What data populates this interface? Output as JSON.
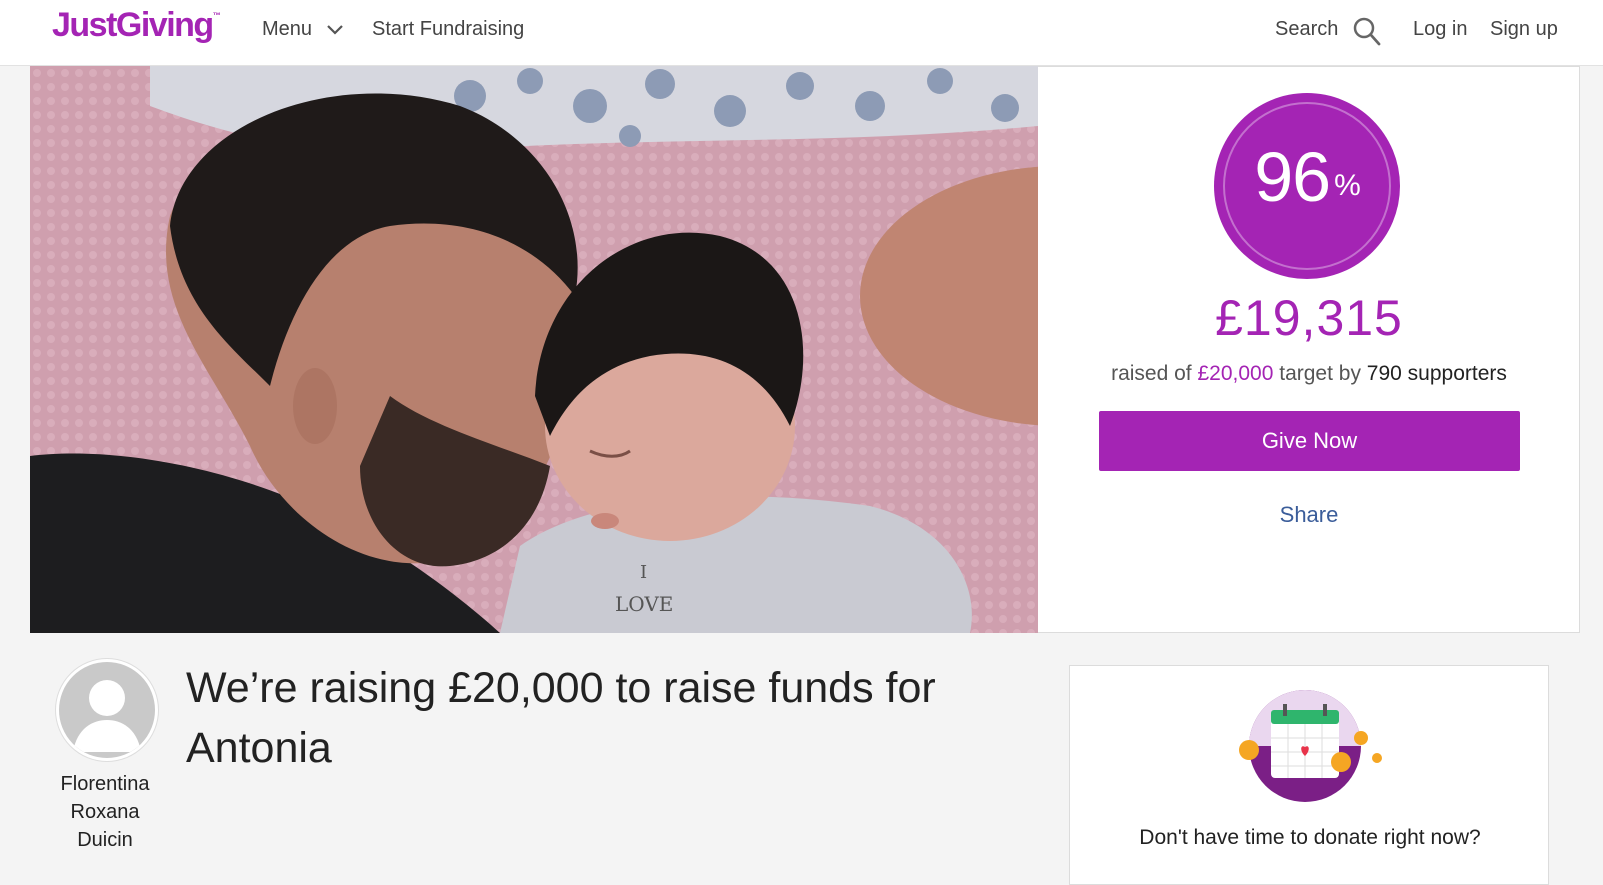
{
  "header": {
    "logo": "JustGiving",
    "logo_tm": "™",
    "menu_label": "Menu",
    "start_label": "Start Fundraising",
    "search_label": "Search",
    "login_label": "Log in",
    "signup_label": "Sign up"
  },
  "donation": {
    "percent": "96",
    "percent_sign": "%",
    "raised": "£19,315",
    "summary_prefix": "raised of ",
    "target": "£20,000",
    "summary_mid": " target by ",
    "supporters": "790 supporters",
    "give_label": "Give Now",
    "share_label": "Share",
    "progress_fraction": 0.96
  },
  "owner": {
    "name_line1": "Florentina",
    "name_line2": "Roxana",
    "name_line3": "Duicin"
  },
  "page_title": "We’re raising £20,000 to raise funds for Antonia",
  "promo": {
    "text": "Don't have time to donate right now?"
  },
  "hero": {
    "shirt_text_1": "I",
    "shirt_text_2": "LOVE"
  },
  "colors": {
    "brand": "#a424b4",
    "link": "#3b5d9a"
  }
}
